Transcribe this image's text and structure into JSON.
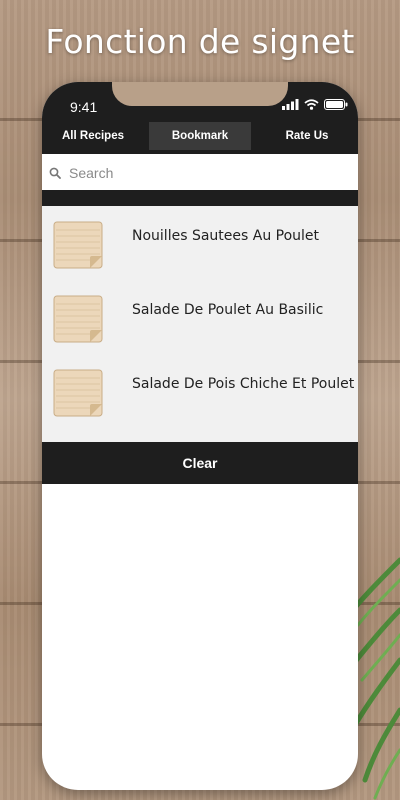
{
  "headline": "Fonction de signet",
  "status_bar": {
    "time": "9:41"
  },
  "tabs": [
    {
      "label": "All Recipes",
      "active": false
    },
    {
      "label": "Bookmark",
      "active": true
    },
    {
      "label": "Rate Us",
      "active": false
    }
  ],
  "search": {
    "placeholder": "Search",
    "value": ""
  },
  "bookmarks": [
    {
      "title": "Nouilles Sautees Au Poulet",
      "icon": "note-paper-icon"
    },
    {
      "title": "Salade De Poulet Au Basilic",
      "icon": "note-paper-icon"
    },
    {
      "title": "Salade De Pois Chiche Et Poulet",
      "icon": "note-paper-icon"
    }
  ],
  "clear_button": {
    "label": "Clear"
  },
  "colors": {
    "bar": "#1e1e1e",
    "active_tab": "#3a3a3a",
    "list_bg": "#f1f1f1"
  }
}
